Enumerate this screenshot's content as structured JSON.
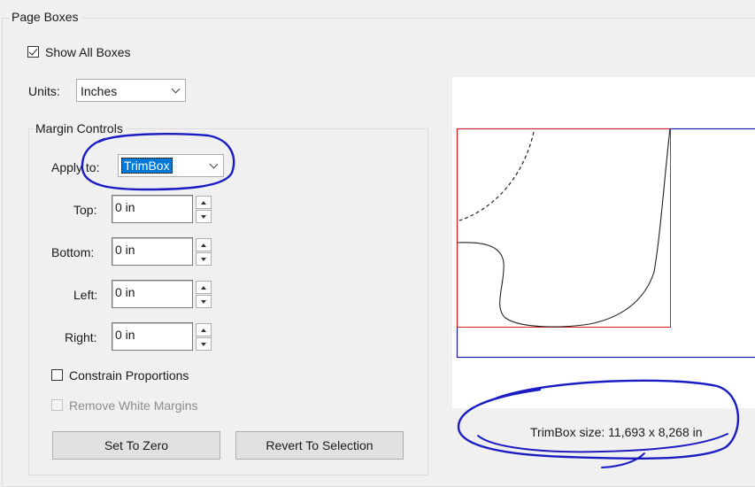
{
  "group": {
    "title": "Page Boxes"
  },
  "show_all_boxes": {
    "label": "Show All Boxes",
    "checked": true
  },
  "units": {
    "label": "Units:",
    "value": "Inches"
  },
  "margin_controls": {
    "title": "Margin Controls",
    "apply_to": {
      "label": "Apply to:",
      "value": "TrimBox"
    },
    "fields": [
      {
        "label": "Top:",
        "value": "0 in"
      },
      {
        "label": "Bottom:",
        "value": "0 in"
      },
      {
        "label": "Left:",
        "value": "0 in"
      },
      {
        "label": "Right:",
        "value": "0 in"
      }
    ],
    "constrain_proportions": {
      "label": "Constrain Proportions",
      "checked": false
    },
    "remove_white_margins": {
      "label": "Remove White Margins",
      "checked": false,
      "enabled": false
    },
    "buttons": {
      "set_to_zero": "Set To Zero",
      "revert_to_selection": "Revert To Selection"
    }
  },
  "preview": {
    "size_text": "TrimBox size: 11,693 x 8,268 in",
    "colors": {
      "mediabox": "#1a1aa6",
      "trimbox": "#e02020",
      "annotation": "#1b1bc4"
    }
  },
  "icons": [
    "checkbox-checked",
    "chevron-down-icon",
    "spin-up-icon",
    "spin-down-icon"
  ]
}
